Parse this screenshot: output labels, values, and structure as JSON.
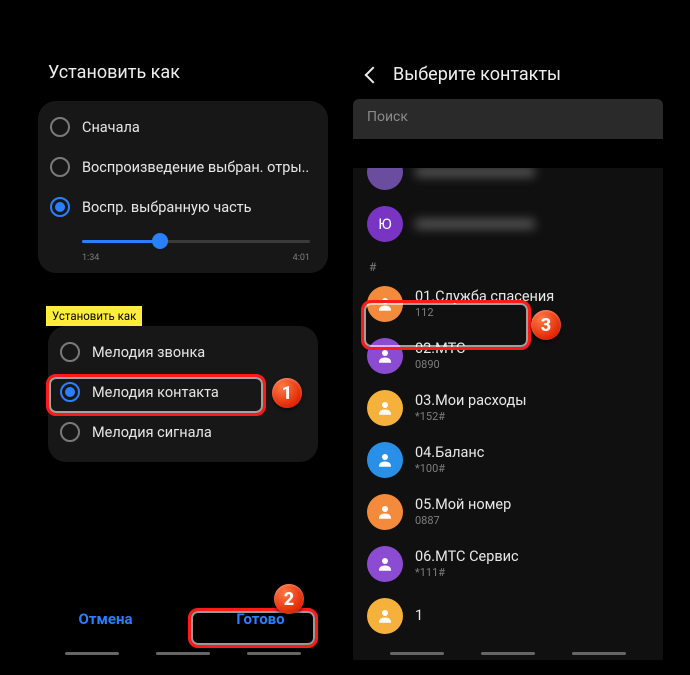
{
  "left": {
    "title": "Установить как",
    "play": {
      "opt1": "Сначала",
      "opt2": "Воспроизведение выбран. отры..",
      "opt3": "Воспр. выбранную часть",
      "t_start": "1:34",
      "t_end": "4:01"
    },
    "tag": "Установить как",
    "setas": {
      "opt1": "Мелодия звонка",
      "opt2": "Мелодия контакта",
      "opt3": "Мелодия сигнала"
    },
    "footer": {
      "cancel": "Отмена",
      "done": "Готово"
    }
  },
  "right": {
    "title": "Выберите контакты",
    "search_ph": "Поиск",
    "avatar_letter": "Ю",
    "section": "#",
    "contacts": [
      {
        "name": "01.Служба спасения",
        "sub": "112",
        "color": "#f48a3b"
      },
      {
        "name": "02.МТС",
        "sub": "0890",
        "color": "#8c4cd1"
      },
      {
        "name": "03.Мои расходы",
        "sub": "*152#",
        "color": "#f4b13b"
      },
      {
        "name": "04.Баланс",
        "sub": "*100#",
        "color": "#2a8fe6"
      },
      {
        "name": "05.Мой номер",
        "sub": "0887",
        "color": "#f48a3b"
      },
      {
        "name": "06.МТС Сервис",
        "sub": "*111#",
        "color": "#8c4cd1"
      },
      {
        "name": "1",
        "sub": "",
        "color": "#f4b13b"
      }
    ]
  },
  "steps": {
    "s1": "1",
    "s2": "2",
    "s3": "3"
  }
}
